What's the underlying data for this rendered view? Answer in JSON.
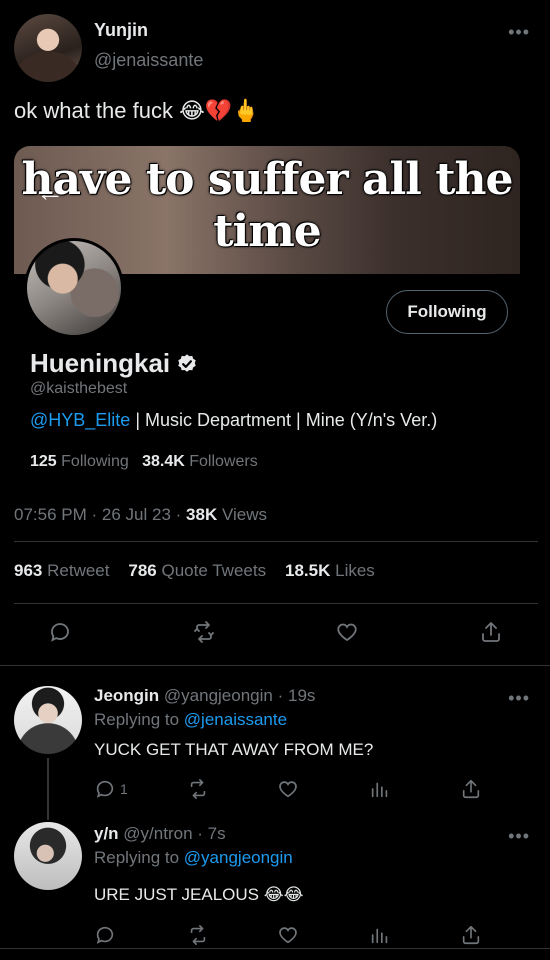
{
  "main_tweet": {
    "author_name": "Yunjin",
    "author_handle": "@jenaissante",
    "text": "ok what the fuck 😂💔🖕",
    "card": {
      "image_text_line1": "have to suffer all the",
      "image_text_line2": "time"
    },
    "profile": {
      "follow_button_label": "Following",
      "name": "Hueningkai",
      "handle": "@kaisthebest",
      "bio_mention": "@HYB_Elite",
      "bio_rest": " | Music Department | Mine (Y/n's Ver.)",
      "following_count": "125",
      "following_label": "Following",
      "followers_count": "38.4K",
      "followers_label": "Followers"
    },
    "time": "07:56 PM",
    "date": "26 Jul 23",
    "views_count": "38K",
    "views_label": "Views",
    "retweet_count": "963",
    "retweet_label": "Retweet",
    "quote_count": "786",
    "quote_label": "Quote Tweets",
    "likes_count": "18.5K",
    "likes_label": "Likes"
  },
  "replies": [
    {
      "name": "Jeongin",
      "handle": "@yangjeongin",
      "time": "19s",
      "replying_label": "Replying to",
      "replying_to": "@jenaissante",
      "text": "YUCK GET THAT AWAY FROM ME?",
      "reply_count": "1"
    },
    {
      "name": "y/n",
      "handle": "@y/ntron",
      "time": "7s",
      "replying_label": "Replying to",
      "replying_to": "@yangjeongin",
      "text": "URE JUST JEALOUS 😂😂",
      "reply_count": ""
    }
  ],
  "ui": {
    "more_glyph": "•••",
    "dot_separator": "·",
    "back_arrow": "←",
    "accent_color": "#1d9bf0",
    "background_color": "#000000",
    "icons": [
      "reply-icon",
      "retweet-icon",
      "like-icon",
      "share-icon",
      "analytics-icon",
      "verified-icon"
    ]
  }
}
